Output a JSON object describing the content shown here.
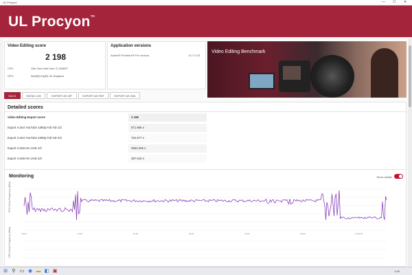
{
  "window": {
    "app_name": "UL Procyon",
    "controls": [
      "—",
      "☐",
      "✕"
    ]
  },
  "header": {
    "logo": "UL Procyon",
    "logo_mark": "™"
  },
  "score": {
    "title": "Video Editing score",
    "value": "2 198",
    "cpu_label": "CPU",
    "cpu_value": "11th Gen Intel Core i7-1165G7",
    "gpu_label": "GPU",
    "gpu_value": "Intel(R) Iris(R) Xe Graphics"
  },
  "versions": {
    "title": "Application versions",
    "app": "Adobe® Premiere® Pro version",
    "version": "14.7.0.23"
  },
  "banner": {
    "title": "Video Editing Benchmark"
  },
  "buttons": {
    "back": "BACK",
    "show_log": "SHOW LOG",
    "export_zip": "EXPORT AS ZIP",
    "export_pdf": "EXPORT AS PDF",
    "export_xml": "EXPORT AS XML"
  },
  "details": {
    "title": "Detailed scores",
    "rows": [
      {
        "label": "Video Editing Export score",
        "value": "2 198"
      },
      {
        "label": "Export H.264 YouTube 1080p Full HD 1/2",
        "value": "871.966 s"
      },
      {
        "label": "Export H.264 YouTube 1080p Full HD 2/2",
        "value": "762.677 s"
      },
      {
        "label": "Export H.265 HK UHD 1/2",
        "value": "4553.258 s"
      },
      {
        "label": "Export H.265 HK UHD 2/2",
        "value": "397.918 s"
      }
    ]
  },
  "monitoring": {
    "title": "Monitoring",
    "show_details": "Show details",
    "show_details_on": true,
    "series_color": "#8b3fb8",
    "chart1_ylabel": "CPU Clock Frequency (MHz)",
    "chart2_ylabel": "GPU Clock Frequency (MHz)",
    "x_ticks": [
      "00:00",
      "05:00",
      "10:00",
      "15:00",
      "20:00",
      "25:00",
      "30:00",
      "35:00",
      "40:00",
      "45:00",
      "50:00",
      "55:00",
      "01:00:00",
      "01:05:00"
    ]
  },
  "taskbar": {
    "time": "1:40"
  },
  "colors": {
    "brand": "#a3243b",
    "toggle": "#c8102e"
  }
}
